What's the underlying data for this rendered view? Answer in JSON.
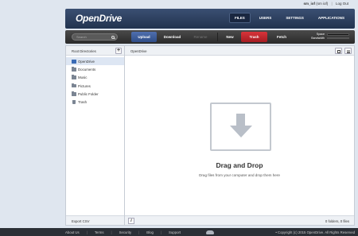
{
  "user": {
    "username": "sm_iof",
    "suffix": "(sm iof)",
    "logout": "Log Out"
  },
  "header": {
    "logo": "OpenDrive",
    "nav": [
      "FILES",
      "USERS",
      "SETTINGS",
      "APPLICATIONS"
    ]
  },
  "toolbar": {
    "search_placeholder": "Search",
    "upload": "Upload",
    "download": "Download",
    "rename": "Rename",
    "new": "New",
    "trash": "Trash",
    "fetch": "Fetch",
    "space_label_1": "Space",
    "space_label_2": "Bandwidth"
  },
  "sidebar": {
    "title": "Root Directories",
    "add": "+",
    "items": [
      {
        "label": "OpenDrive"
      },
      {
        "label": "Documents"
      },
      {
        "label": "Music"
      },
      {
        "label": "Pictures"
      },
      {
        "label": "Public Folder"
      },
      {
        "label": "Trash"
      }
    ],
    "export": "Export CSV"
  },
  "content": {
    "breadcrumb": "OpenDrive",
    "drop_title": "Drag and Drop",
    "drop_sub": "Drag files from your computer and drop them here",
    "info": "i",
    "count": "0 folders, 0 files"
  },
  "footer": {
    "links": [
      "About Us",
      "Terms",
      "Security",
      "Blog",
      "Support"
    ],
    "copyright": "• Copyright (c) 2015 OpenDrive. All Rights Reserved"
  },
  "colors": {
    "header": "#2c3e5e",
    "accent": "#3a5a9a",
    "trash": "#c8262c",
    "footer": "#2b2f36"
  }
}
